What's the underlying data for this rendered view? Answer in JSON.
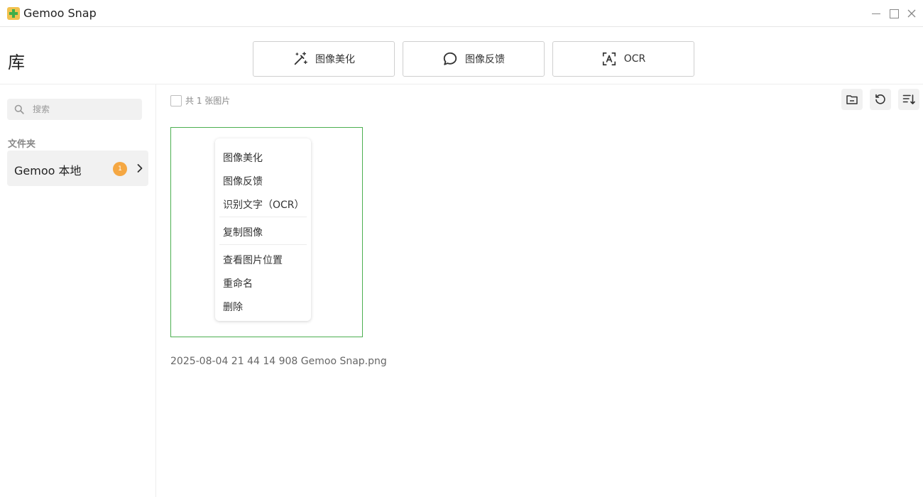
{
  "titlebar": {
    "app_title": "Gemoo Snap"
  },
  "header": {
    "title": "库",
    "buttons": {
      "beautify": "图像美化",
      "feedback": "图像反馈",
      "ocr": "OCR"
    }
  },
  "sidebar": {
    "search_placeholder": "搜索",
    "folder_header": "文件夹",
    "folders": [
      {
        "label": "Gemoo 本地",
        "count": "1"
      }
    ]
  },
  "toolbar": {
    "count_text": "共 1 张图片"
  },
  "images": [
    {
      "file_name": "2025-08-04 21 44 14 908  Gemoo Snap.png"
    }
  ],
  "context_menu": {
    "items": [
      "图像美化",
      "图像反馈",
      "识别文字（OCR）",
      "复制图像",
      "查看图片位置",
      "重命名",
      "删除"
    ]
  },
  "colors": {
    "accent_green": "#4caf50",
    "badge_orange": "#f5a742"
  }
}
